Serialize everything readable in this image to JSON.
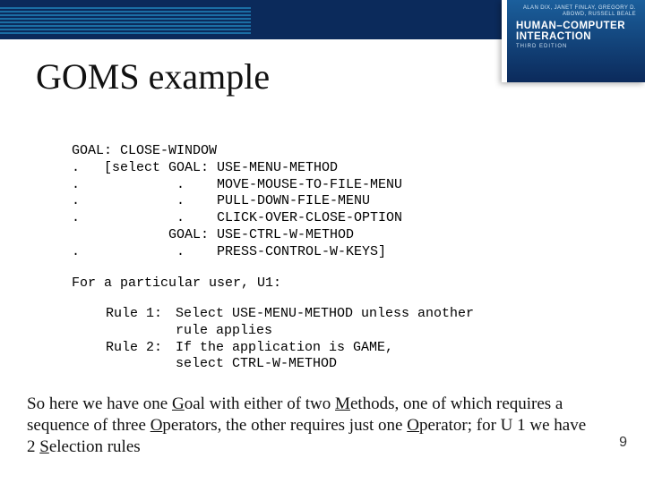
{
  "book": {
    "authors": "ALAN DIX, JANET FINLAY, GREGORY D. ABOWD, RUSSELL BEALE",
    "title_line1": "HUMAN–COMPUTER",
    "title_line2": "INTERACTION",
    "edition": "THIRD EDITION"
  },
  "slide": {
    "title": "GOMS example",
    "page_number": "9"
  },
  "goms": {
    "l1": "GOAL: CLOSE-WINDOW",
    "l2": ".   [select GOAL: USE-MENU-METHOD",
    "l3": ".            .    MOVE-MOUSE-TO-FILE-MENU",
    "l4": ".            .    PULL-DOWN-FILE-MENU",
    "l5": ".            .    CLICK-OVER-CLOSE-OPTION",
    "l6": "            GOAL: USE-CTRL-W-METHOD",
    "l7": ".            .    PRESS-CONTROL-W-KEYS]"
  },
  "user_line": "For a particular user, U1:",
  "rules": {
    "r1_label": "Rule 1:",
    "r1a": "Select USE-MENU-METHOD unless another",
    "r1b": "rule applies",
    "r2_label": "Rule 2:",
    "r2a": "If the application is GAME,",
    "r2b": "select CTRL-W-METHOD"
  },
  "summary": {
    "pre_g": "So here we have one ",
    "g": "G",
    "post_g": "oal with either of two ",
    "m": "M",
    "post_m": "ethods, one of which requires a sequence of three ",
    "o1": "O",
    "post_o1": "perators, the other requires just one ",
    "o2": "O",
    "post_o2": "perator; for U 1 we have 2 ",
    "s": "S",
    "post_s": "election rules"
  }
}
